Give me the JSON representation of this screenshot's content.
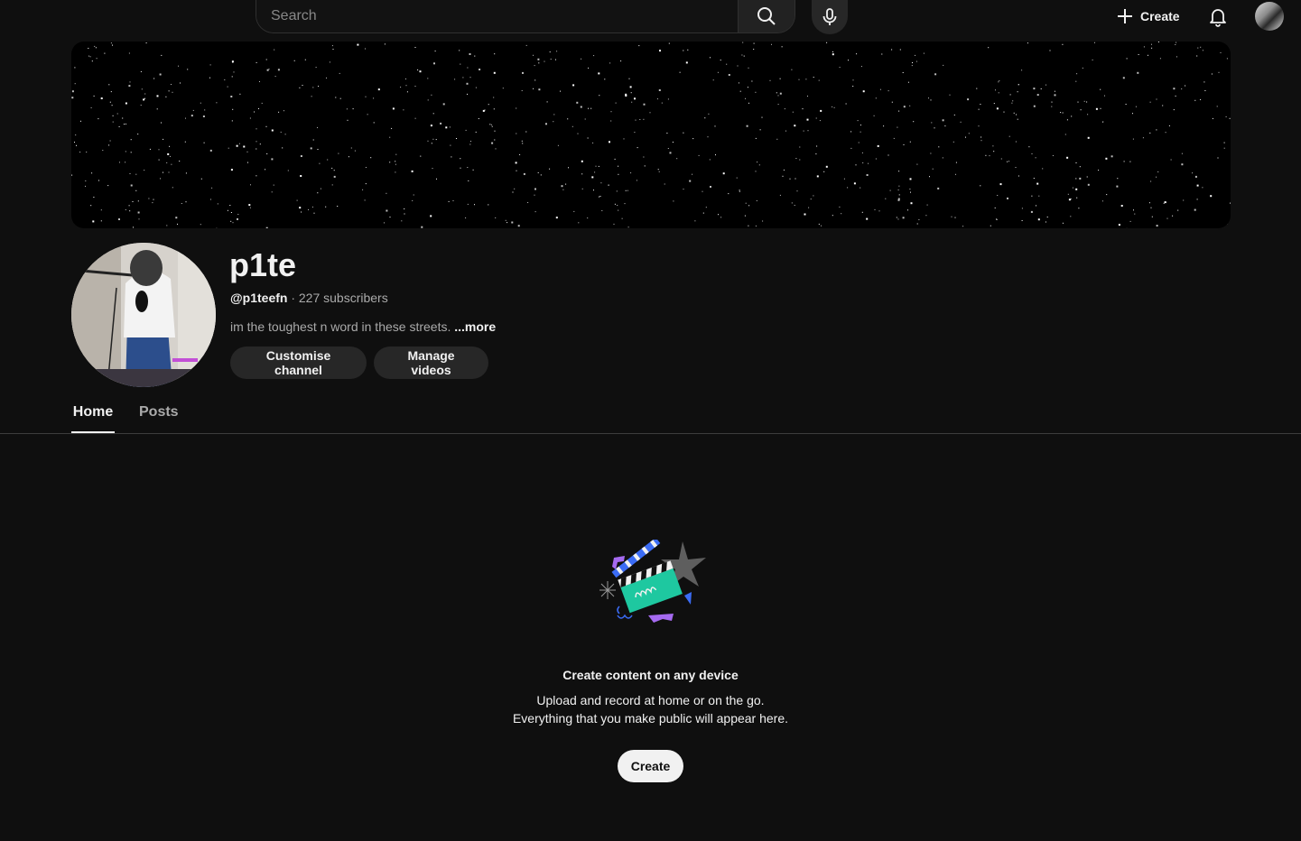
{
  "topbar": {
    "search_placeholder": "Search",
    "create_label": "Create"
  },
  "channel": {
    "name": "p1te",
    "handle": "@p1teefn",
    "subscribers": "227 subscribers",
    "separator": "·",
    "description": "im the toughest n word in these streets.",
    "more_label": "...more",
    "customise_label": "Customise channel",
    "manage_label": "Manage videos"
  },
  "tabs": [
    {
      "label": "Home",
      "active": true
    },
    {
      "label": "Posts",
      "active": false
    }
  ],
  "empty_state": {
    "title": "Create content on any device",
    "line1": "Upload and record at home or on the go.",
    "line2": "Everything that you make public will appear here.",
    "button_label": "Create"
  },
  "colors": {
    "background": "#0f0f0f",
    "text": "#f1f1f1",
    "secondary_text": "#aaaaaa",
    "pill": "#272727",
    "accent_green": "#1ec8a0",
    "accent_blue": "#3b6cf5",
    "accent_purple": "#a56af0"
  }
}
